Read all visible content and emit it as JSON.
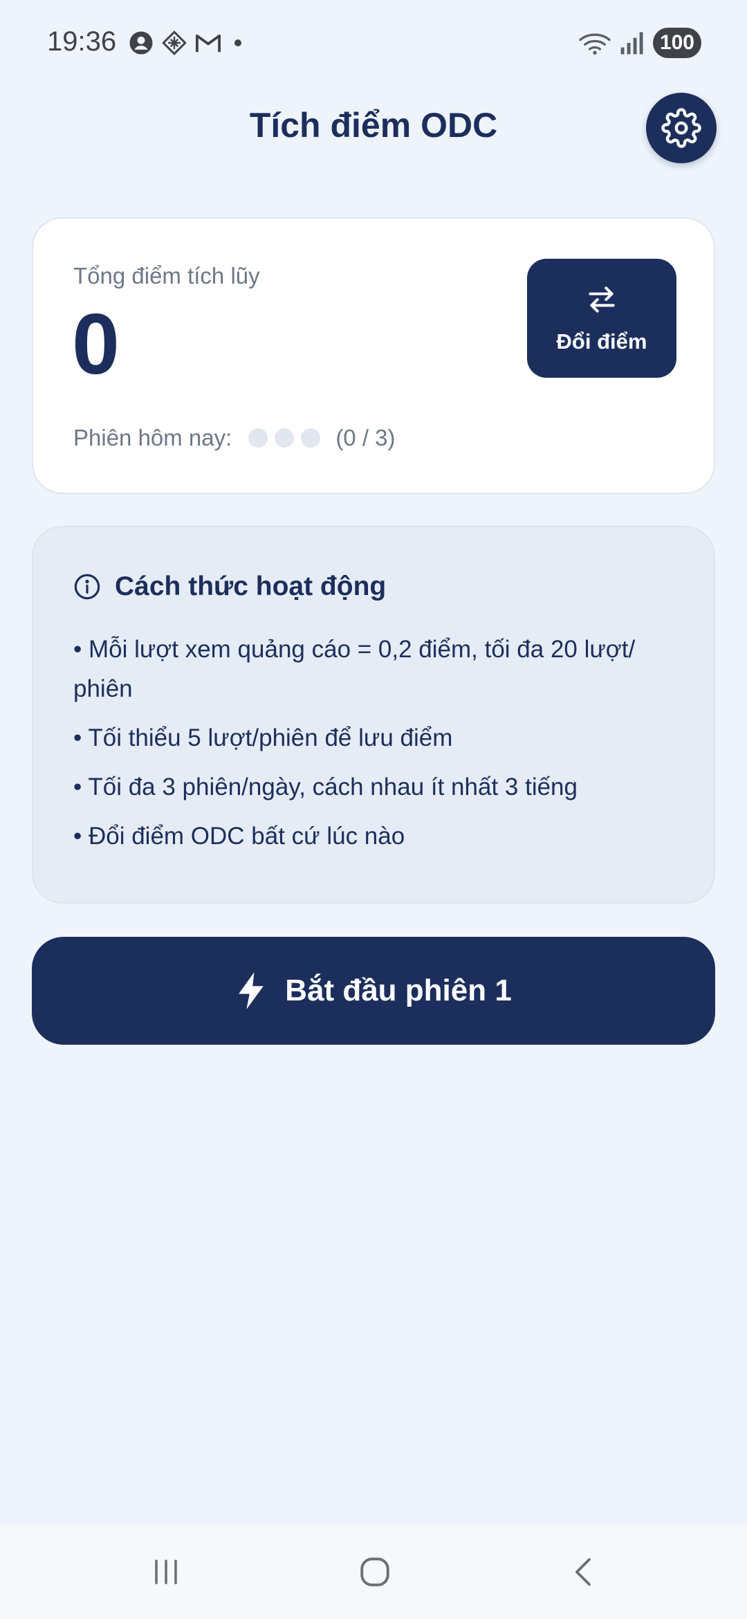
{
  "status_bar": {
    "time": "19:36",
    "battery": "100",
    "left_icons": [
      "account-circle-icon",
      "diamond-grid-icon",
      "gmail-icon",
      "dot-icon"
    ],
    "right_icons": [
      "wifi-icon",
      "signal-icon",
      "battery-icon"
    ]
  },
  "header": {
    "title": "Tích điểm ODC",
    "settings_icon": "gear-icon"
  },
  "points_card": {
    "label": "Tổng điểm tích lũy",
    "value": "0",
    "exchange_button_label": "Đổi điểm",
    "exchange_icon": "swap-arrows-icon",
    "session_label": "Phiên hôm nay:",
    "sessions_done": 0,
    "sessions_total": 3,
    "session_count_text": "(0 / 3)"
  },
  "info_card": {
    "title": "Cách thức hoạt động",
    "icon": "info-icon",
    "items": [
      "• Mỗi lượt xem quảng cáo = 0,2 điểm, tối đa 20 lượt/ phiên",
      "• Tối thiểu 5 lượt/phiên để lưu điểm",
      "• Tối đa 3 phiên/ngày, cách nhau ít nhất 3 tiếng",
      "• Đổi điểm ODC bất cứ lúc nào"
    ]
  },
  "start_button": {
    "label": "Bắt đầu phiên 1",
    "icon": "lightning-icon"
  },
  "nav_bar": {
    "buttons": [
      "recent-apps-icon",
      "home-icon",
      "back-icon"
    ]
  },
  "colors": {
    "primary": "#1c2e5c",
    "background": "#eff4fc",
    "card": "#ffffff",
    "info_card": "#e6ecf5",
    "muted_text": "#6e7787"
  }
}
